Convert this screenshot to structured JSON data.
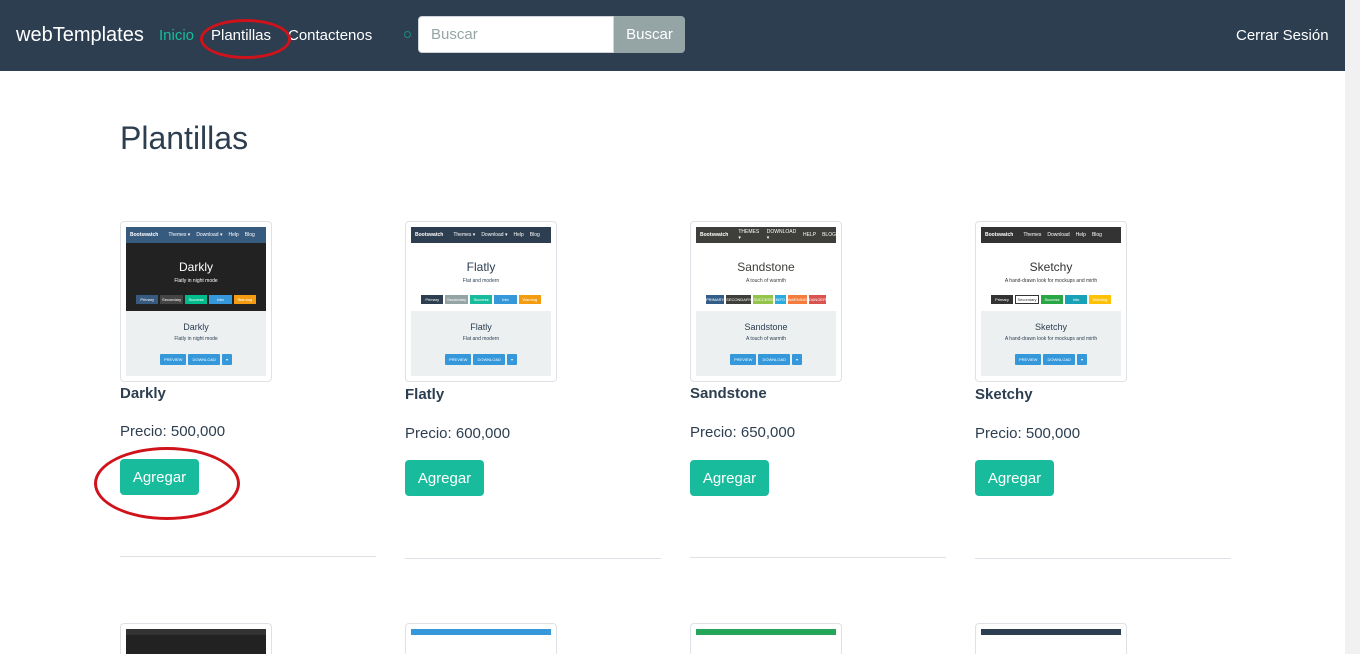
{
  "navbar": {
    "brand": "webTemplates",
    "links": [
      {
        "label": "Inicio",
        "active": true
      },
      {
        "label": "Plantillas",
        "active": false
      },
      {
        "label": "Contactenos",
        "active": false
      }
    ],
    "search_placeholder": "Buscar",
    "search_button": "Buscar",
    "logout": "Cerrar Sesión"
  },
  "page": {
    "title": "Plantillas"
  },
  "price_prefix": "Precio: ",
  "add_label": "Agregar",
  "templates": [
    {
      "name": "Darkly",
      "price": "500,000",
      "thumb": {
        "nav": "#375a7f",
        "hero": "#222222",
        "hero_text": "#ffffff",
        "title": "Darkly",
        "sub": "Flatly in night mode",
        "buttons": [
          {
            "t": "Primary",
            "c": "#375a7f"
          },
          {
            "t": "Secondary",
            "c": "#444444"
          },
          {
            "t": "Success",
            "c": "#00bc8c"
          },
          {
            "t": "Info",
            "c": "#3498db"
          },
          {
            "t": "Warning",
            "c": "#f39c12"
          }
        ],
        "lower_title": "Darkly",
        "lower_sub": "Flatly in night mode",
        "nav_items": [
          "Bootswatch",
          "Themes ▾",
          "Download ▾",
          "Help",
          "Blog"
        ]
      }
    },
    {
      "name": "Flatly",
      "price": "600,000",
      "thumb": {
        "nav": "#2c3e50",
        "hero": "#ffffff",
        "hero_text": "#2c3e50",
        "title": "Flatly",
        "sub": "Flat and modern",
        "buttons": [
          {
            "t": "Primary",
            "c": "#2c3e50"
          },
          {
            "t": "Secondary",
            "c": "#95a5a6"
          },
          {
            "t": "Success",
            "c": "#18bc9c"
          },
          {
            "t": "Info",
            "c": "#3498db"
          },
          {
            "t": "Warning",
            "c": "#f39c12"
          }
        ],
        "lower_title": "Flatly",
        "lower_sub": "Flat and modern",
        "nav_items": [
          "Bootswatch",
          "Themes ▾",
          "Download ▾",
          "Help",
          "Blog"
        ]
      }
    },
    {
      "name": "Sandstone",
      "price": "650,000",
      "thumb": {
        "nav": "#3e3f3a",
        "hero": "#ffffff",
        "hero_text": "#3e3f3a",
        "title": "Sandstone",
        "sub": "A touch of warmth",
        "buttons": [
          {
            "t": "PRIMARY",
            "c": "#325d88"
          },
          {
            "t": "SECONDARY",
            "c": "#3e3f3a"
          },
          {
            "t": "SUCCESS",
            "c": "#93c54b"
          },
          {
            "t": "INFO",
            "c": "#29abe0"
          },
          {
            "t": "WARNING",
            "c": "#f47c3c"
          },
          {
            "t": "DANGER",
            "c": "#d9534f"
          }
        ],
        "lower_title": "Sandstone",
        "lower_sub": "A touch of warmth",
        "nav_items": [
          "Bootswatch",
          "THEMES ▾",
          "DOWNLOAD ▾",
          "HELP",
          "BLOG"
        ]
      }
    },
    {
      "name": "Sketchy",
      "price": "500,000",
      "thumb": {
        "nav": "#333333",
        "hero": "#ffffff",
        "hero_text": "#333333",
        "title": "Sketchy",
        "sub": "A hand-drawn look for mockups and mirth",
        "buttons": [
          {
            "t": "Primary",
            "c": "#333333"
          },
          {
            "t": "Secondary",
            "c": "#ffffff"
          },
          {
            "t": "Success",
            "c": "#28a745"
          },
          {
            "t": "Info",
            "c": "#17a2b8"
          },
          {
            "t": "Warning",
            "c": "#ffc107"
          }
        ],
        "lower_title": "Sketchy",
        "lower_sub": "A hand-drawn look for mockups and mirth",
        "nav_items": [
          "Bootswatch",
          "Themes",
          "Download",
          "Help",
          "Blog"
        ]
      }
    }
  ],
  "thumb_actions": [
    "PREVIEW",
    "DOWNLOAD",
    "▾"
  ],
  "colors": {
    "navbar": "#2c3e50",
    "accent": "#18bc9c",
    "annotation": "#d0121b"
  }
}
